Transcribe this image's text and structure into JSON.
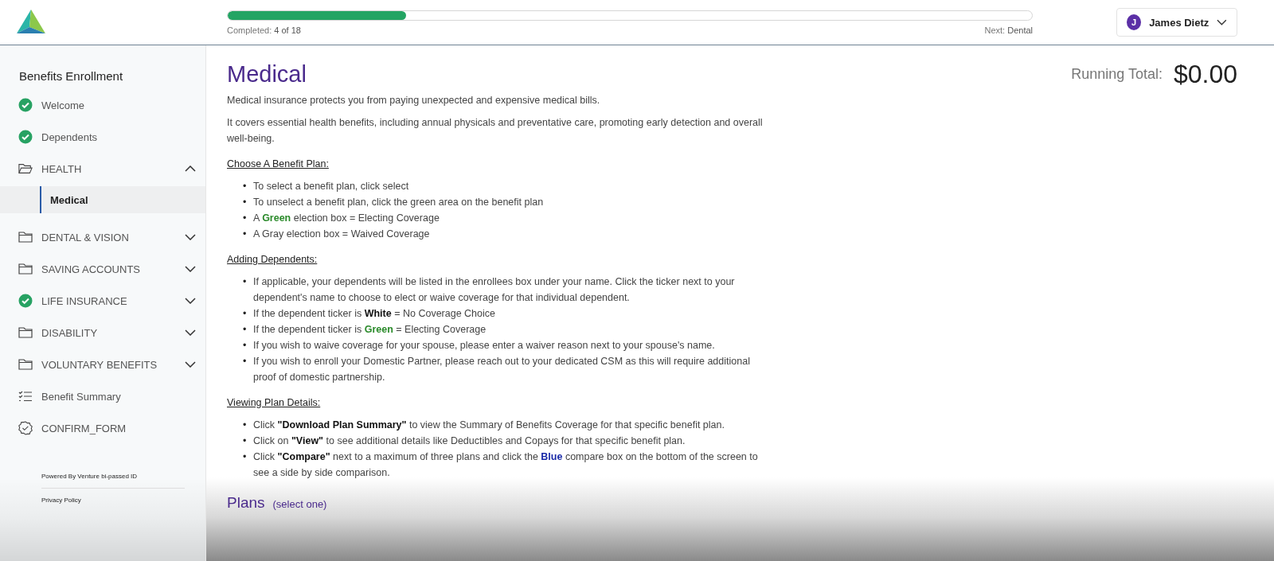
{
  "header": {
    "progress": {
      "level": 0.222,
      "completed_label": "Completed:",
      "completed_value": "4 of 18",
      "next_label": "Next:",
      "next_value": "Dental"
    },
    "user": {
      "initial": "J",
      "name": "James Dietz"
    }
  },
  "sidebar": {
    "title": "Benefits Enrollment",
    "items": [
      {
        "label": "Welcome",
        "kind": "check"
      },
      {
        "label": "Dependents",
        "kind": "check"
      },
      {
        "label": "HEALTH",
        "kind": "folder",
        "expanded": true,
        "children": [
          {
            "label": "Medical",
            "selected": true
          }
        ]
      },
      {
        "label": "DENTAL & VISION",
        "kind": "folder",
        "expanded": false
      },
      {
        "label": "SAVING ACCOUNTS",
        "kind": "folder",
        "expanded": false
      },
      {
        "label": "LIFE INSURANCE",
        "kind": "check",
        "expanded": false
      },
      {
        "label": "DISABILITY",
        "kind": "folder",
        "expanded": false
      },
      {
        "label": "VOLUNTARY BENEFITS",
        "kind": "folder",
        "expanded": false
      },
      {
        "label": "Benefit Summary",
        "kind": "list"
      },
      {
        "label": "CONFIRM_FORM",
        "kind": "badge"
      }
    ],
    "powered_by": "Powered By Venture  bi-passed ID",
    "privacy": "Privacy Policy"
  },
  "main": {
    "title": "Medical",
    "running_total_label": "Running Total:",
    "running_total": "$0.00",
    "paragraphs": [
      "Medical insurance protects you from paying unexpected and expensive medical bills.",
      "It covers essential health benefits, including annual physicals and preventative care, promoting early detection and overall well-being."
    ],
    "bullet_marker": "•",
    "sections": [
      {
        "heading": "Choose A Benefit Plan:",
        "bullets": [
          [
            {
              "text": "To select a benefit plan, click select",
              "kind": "plain"
            }
          ],
          [
            {
              "text": "To unselect a benefit plan, click the green area on the benefit plan",
              "kind": "plain"
            }
          ],
          [
            {
              "text": "A ",
              "kind": "plain"
            },
            {
              "text": "Green",
              "kind": "green"
            },
            {
              "text": " election box = Electing Coverage",
              "kind": "plain"
            }
          ],
          [
            {
              "text": "A Gray election box = Waived Coverage",
              "kind": "plain"
            }
          ]
        ]
      },
      {
        "heading": "Adding Dependents:",
        "bullets": [
          [
            {
              "text": "If applicable, your dependents will be listed in the enrollees box under your name. Click the ticker next to your dependent's name to choose to elect or waive coverage for that individual dependent.",
              "kind": "plain"
            }
          ],
          [
            {
              "text": "If the dependent ticker is ",
              "kind": "plain"
            },
            {
              "text": "White",
              "kind": "strong"
            },
            {
              "text": " = No Coverage Choice",
              "kind": "plain"
            }
          ],
          [
            {
              "text": "If the dependent ticker is ",
              "kind": "plain"
            },
            {
              "text": "Green",
              "kind": "green"
            },
            {
              "text": " = Electing Coverage",
              "kind": "plain"
            }
          ],
          [
            {
              "text": "If you wish to waive coverage for your spouse, please enter a waiver reason next to your spouse's name.",
              "kind": "plain"
            }
          ],
          [
            {
              "text": "If you wish to enroll your Domestic Partner, please reach out to your dedicated CSM as this will require additional proof of domestic partnership.",
              "kind": "plain"
            }
          ]
        ]
      },
      {
        "heading": "Viewing Plan Details:",
        "bullets": [
          [
            {
              "text": "Click ",
              "kind": "plain"
            },
            {
              "text": "\"Download Plan Summary\"",
              "kind": "strong"
            },
            {
              "text": " to view the Summary of Benefits Coverage for that specific benefit plan.",
              "kind": "plain"
            }
          ],
          [
            {
              "text": "Click on ",
              "kind": "plain"
            },
            {
              "text": "\"View\"",
              "kind": "strong"
            },
            {
              "text": " to see additional details like Deductibles and Copays for that specific benefit plan.",
              "kind": "plain"
            }
          ],
          [
            {
              "text": "Click ",
              "kind": "plain"
            },
            {
              "text": "\"Compare\"",
              "kind": "strong"
            },
            {
              "text": " next to a maximum of three plans and click the ",
              "kind": "plain"
            },
            {
              "text": "Blue",
              "kind": "blue"
            },
            {
              "text": " compare box on the bottom of the screen to see a side by side comparison.",
              "kind": "plain"
            }
          ]
        ]
      }
    ],
    "plans_title": "Plans",
    "plans_hint": "(select one)"
  }
}
